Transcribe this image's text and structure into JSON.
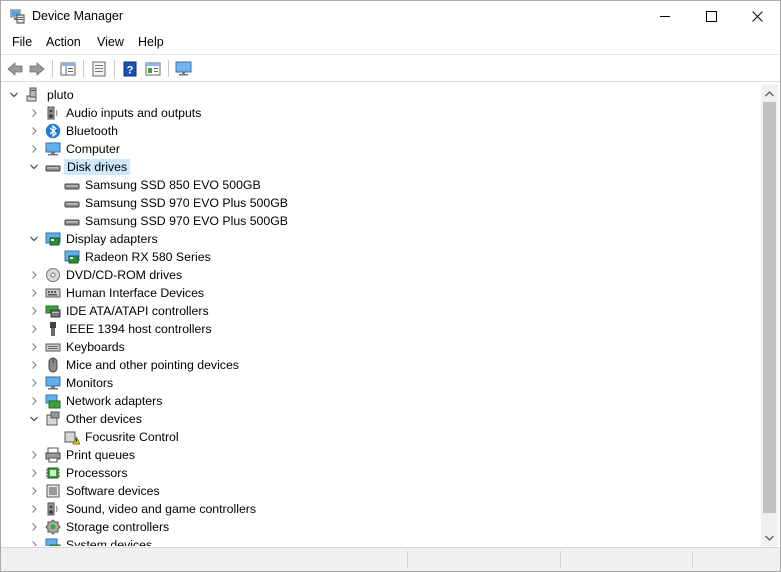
{
  "window": {
    "title": "Device Manager"
  },
  "menu": [
    "File",
    "Action",
    "View",
    "Help"
  ],
  "toolbar": {
    "buttons": [
      "back-icon",
      "forward-icon",
      "tree-view-icon",
      "properties-icon",
      "help-icon",
      "driver-icon",
      "monitor-scan-icon"
    ]
  },
  "tree": {
    "root": "pluto",
    "items": [
      {
        "label": "Audio inputs and outputs",
        "icon": "speaker-icon",
        "expanded": false
      },
      {
        "label": "Bluetooth",
        "icon": "bluetooth-icon",
        "expanded": false
      },
      {
        "label": "Computer",
        "icon": "computer-icon",
        "expanded": false
      },
      {
        "label": "Disk drives",
        "icon": "disk-drive-icon",
        "expanded": true,
        "selected": true,
        "children": [
          "Samsung SSD 850 EVO 500GB",
          "Samsung SSD 970 EVO Plus 500GB",
          "Samsung SSD 970 EVO Plus 500GB"
        ]
      },
      {
        "label": "Display adapters",
        "icon": "display-adapter-icon",
        "expanded": true,
        "children": [
          "Radeon RX 580 Series"
        ]
      },
      {
        "label": "DVD/CD-ROM drives",
        "icon": "dvd-icon",
        "expanded": false
      },
      {
        "label": "Human Interface Devices",
        "icon": "hid-icon",
        "expanded": false
      },
      {
        "label": "IDE ATA/ATAPI controllers",
        "icon": "ide-controller-icon",
        "expanded": false
      },
      {
        "label": "IEEE 1394 host controllers",
        "icon": "ieee1394-icon",
        "expanded": false
      },
      {
        "label": "Keyboards",
        "icon": "keyboard-icon",
        "expanded": false
      },
      {
        "label": "Mice and other pointing devices",
        "icon": "mouse-icon",
        "expanded": false
      },
      {
        "label": "Monitors",
        "icon": "monitor-icon",
        "expanded": false
      },
      {
        "label": "Network adapters",
        "icon": "network-adapter-icon",
        "expanded": false
      },
      {
        "label": "Other devices",
        "icon": "other-devices-icon",
        "expanded": true,
        "children": [
          "Focusrite Control"
        ]
      },
      {
        "label": "Print queues",
        "icon": "printer-icon",
        "expanded": false
      },
      {
        "label": "Processors",
        "icon": "processor-icon",
        "expanded": false
      },
      {
        "label": "Software devices",
        "icon": "software-device-icon",
        "expanded": false
      },
      {
        "label": "Sound, video and game controllers",
        "icon": "sound-icon",
        "expanded": false
      },
      {
        "label": "Storage controllers",
        "icon": "storage-controller-icon",
        "expanded": false
      },
      {
        "label": "System devices",
        "icon": "system-devices-icon",
        "expanded": false
      }
    ]
  },
  "colors": {
    "selection": "#cce8ff",
    "accent_blue": "#1e7bd6",
    "warning": "#f5c400"
  }
}
